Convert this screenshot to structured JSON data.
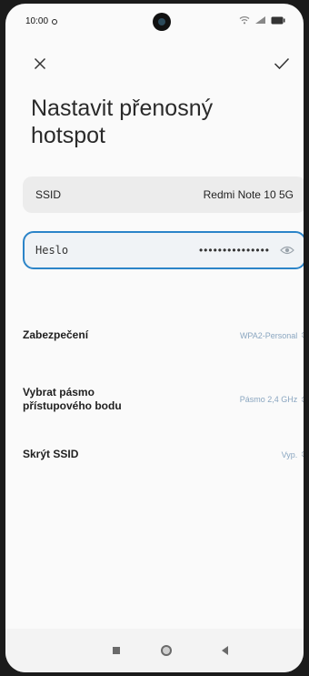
{
  "status_bar": {
    "time": "10:00",
    "icons": [
      "wifi-icon",
      "signal-icon",
      "battery-icon"
    ]
  },
  "toolbar": {
    "close_icon": "close-icon",
    "confirm_icon": "checkmark-icon"
  },
  "page": {
    "title": "Nastavit přenosný hotspot"
  },
  "ssid": {
    "label": "SSID",
    "value": "Redmi Note 10 5G"
  },
  "password": {
    "label": "Heslo",
    "masked_value": "•••••••••••••••",
    "toggle_icon": "eye-icon"
  },
  "settings": [
    {
      "label": "Zabezpečení",
      "value": "WPA2-Personal"
    },
    {
      "label": "Vybrat pásmo přístupového bodu",
      "value": "Pásmo 2,4 GHz"
    },
    {
      "label": "Skrýt SSID",
      "value": "Vyp."
    }
  ],
  "colors": {
    "accent": "#2b84c8",
    "value_text": "#8aa6c0",
    "background": "#fafafa",
    "field_bg": "#ececec"
  }
}
